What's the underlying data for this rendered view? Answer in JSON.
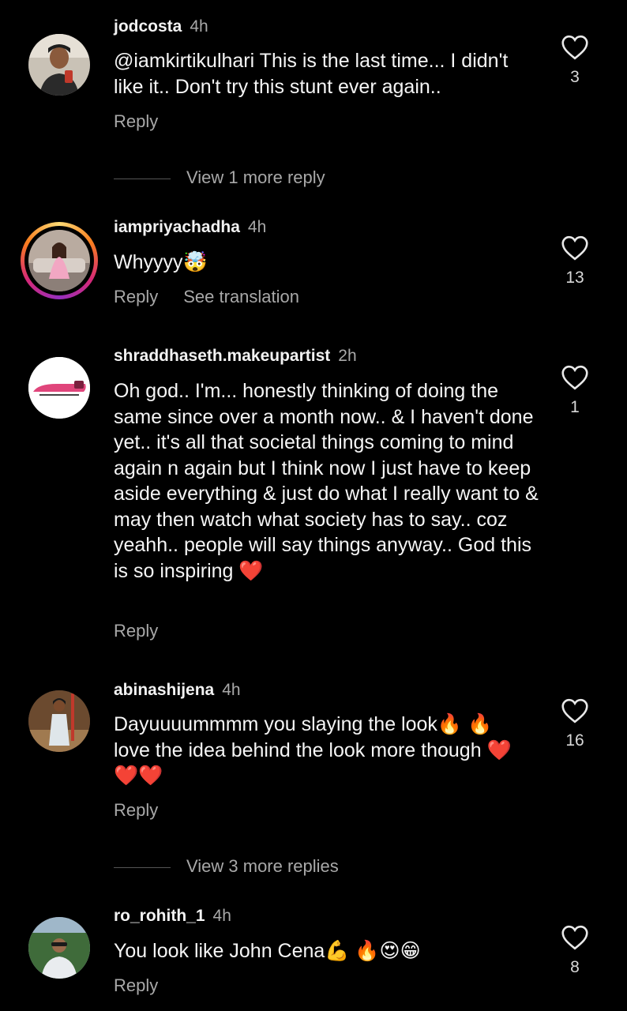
{
  "colors": {
    "background": "#000000",
    "text": "#f5f5f5",
    "muted": "#a8a8a8",
    "heart_red": "#e62940"
  },
  "comments": [
    {
      "username": "jodcosta",
      "time": "4h",
      "text": "@iamkirtikulhari This is the last time... I didn't like it.. Don't try this stunt ever again..",
      "reply_label": "Reply",
      "likes": "3",
      "avatar_icon": "profile-photo"
    },
    {
      "username": "iampriyachadha",
      "time": "4h",
      "text": "Whyyyy🤯",
      "reply_label": "Reply",
      "translation_label": "See translation",
      "likes": "13",
      "avatar_icon": "profile-photo-story-ring"
    },
    {
      "username": "shraddhaseth.makeupartist",
      "time": "2h",
      "text": "Oh god.. I'm... honestly thinking of doing the same since over a month now.. & I haven't done yet.. it's all that societal things coming to mind again n again but I think now I just have to keep aside everything & just do what I really want to & may then watch what society has to say.. coz yeahh.. people will say things anyway.. God this is so inspiring ❤️",
      "reply_label": "Reply",
      "likes": "1",
      "avatar_icon": "brand-logo"
    },
    {
      "username": "abinashijena",
      "time": "4h",
      "text": "Dayuuuummmm you slaying the look🔥 🔥 love the idea behind the look more though ❤️❤️❤️",
      "reply_label": "Reply",
      "likes": "16",
      "avatar_icon": "profile-photo"
    },
    {
      "username": "ro_rohith_1",
      "time": "4h",
      "text": "You look like John Cena💪 🔥😍😁",
      "reply_label": "Reply",
      "likes": "8",
      "avatar_icon": "profile-photo"
    }
  ],
  "view_replies": [
    {
      "label": "View 1 more reply"
    },
    {
      "label": "View 3 more replies"
    }
  ]
}
